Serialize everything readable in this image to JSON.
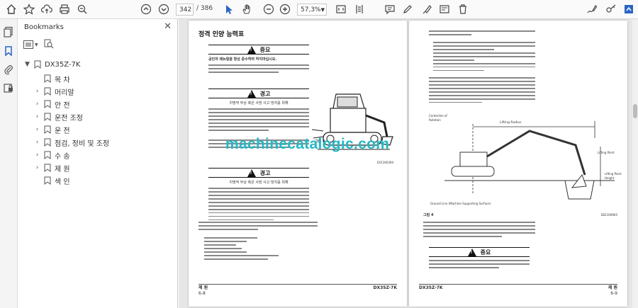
{
  "toolbar": {
    "page_current": "342",
    "page_total": "/ 386",
    "zoom": "57,3%"
  },
  "panel": {
    "title": "Bookmarks",
    "items": [
      {
        "label": "DX35Z-7K",
        "expand": "▼"
      },
      {
        "label": "목 차",
        "expand": ""
      },
      {
        "label": "머리말",
        "expand": "›"
      },
      {
        "label": "안 전",
        "expand": "›"
      },
      {
        "label": "운전 조정",
        "expand": "›"
      },
      {
        "label": "운 전",
        "expand": "›"
      },
      {
        "label": "점검, 정비 및 조정",
        "expand": "›"
      },
      {
        "label": "수 송",
        "expand": "›"
      },
      {
        "label": "제 원",
        "expand": "›"
      },
      {
        "label": "색 인",
        "expand": ""
      }
    ]
  },
  "left_page": {
    "heading": "정격 인양 능력표",
    "caution1_label": "중요",
    "caution1_text": "공인자 매뉴얼을 항상 준수하여 하지마십시오.",
    "warning_label": "경고",
    "warning_sub": "치명적 부상 혹은 사망 사고 방지를 위해",
    "warning2_label": "경고",
    "warning2_sub": "치명적 부상 혹은 사망 사고 방지를 위해",
    "figure_label": "그림 3",
    "figure_code": "EX1300394",
    "footer_left": "제 원",
    "footer_page": "6-8",
    "footer_model": "DX35Z-7K"
  },
  "right_page": {
    "fig_labels": {
      "centerline": "Centerline of Rotation",
      "lifting_radius": "Lifting Radius",
      "lifting_point": "Lifting Point",
      "lifting_point_height": "Lifting Point Height",
      "ground_line": "Ground Line (Machine Supporting Surface)"
    },
    "figure_label": "그림 4",
    "figure_code": "DS2100905",
    "caution_label": "중요",
    "footer_model": "DX35Z-7K",
    "footer_right": "제 원",
    "footer_page": "6-9"
  },
  "watermark": "machinecatalogic.com",
  "colors": {
    "accent": "#25b9c6",
    "toolbar_bg": "#fafafa"
  }
}
